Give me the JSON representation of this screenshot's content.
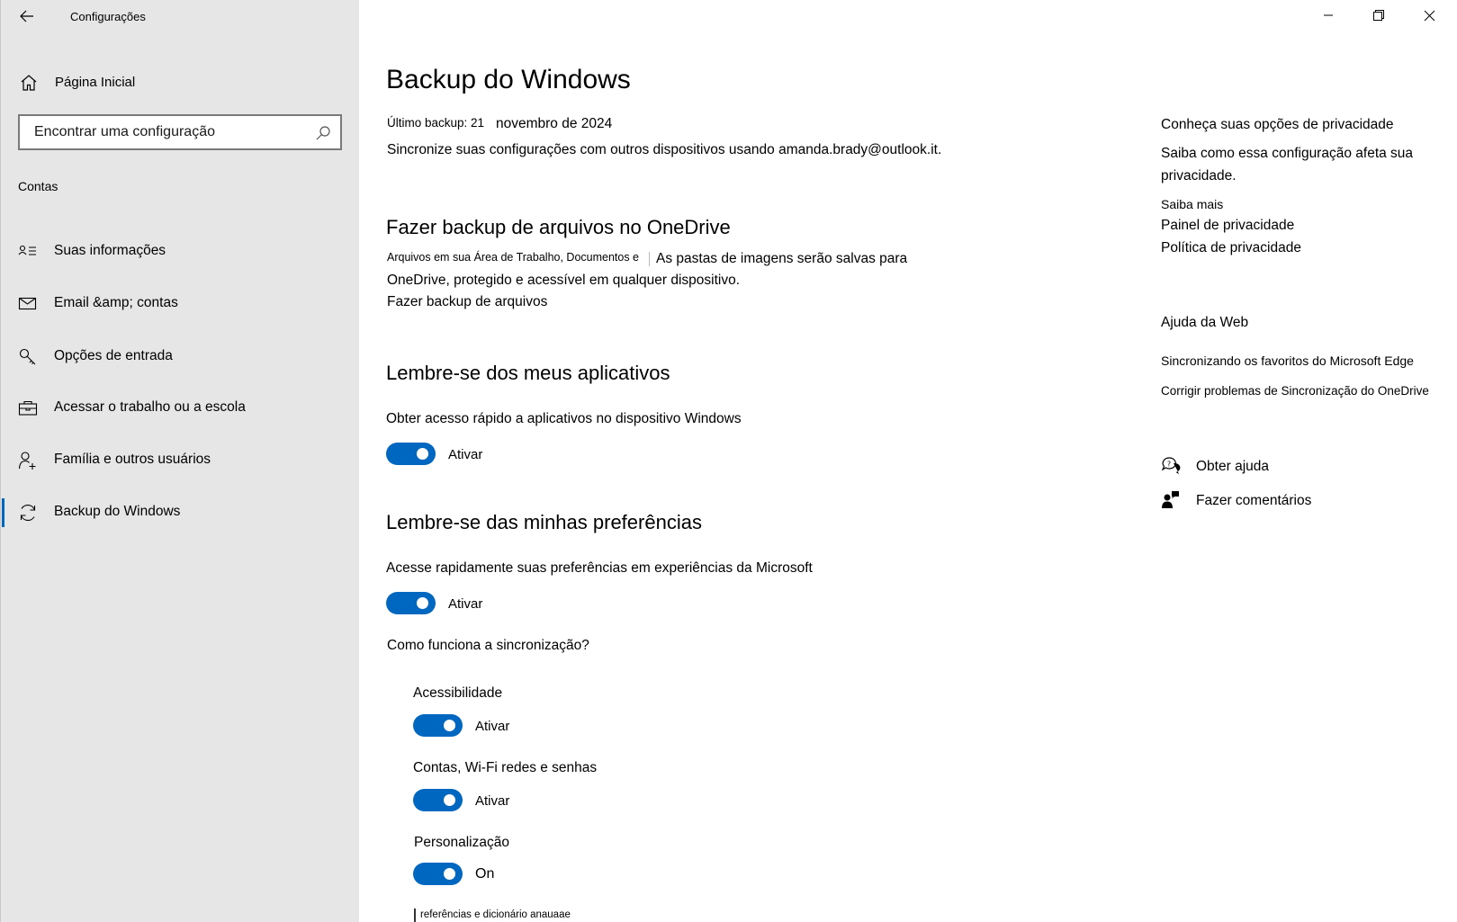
{
  "window": {
    "title": "Configurações",
    "caption_buttons": [
      "minimize-icon",
      "restore-icon",
      "close-icon"
    ]
  },
  "sidebar": {
    "home_label": "Página Inicial",
    "search_placeholder": "Encontrar uma configuração",
    "section_label": "Contas",
    "items": [
      {
        "label": "Suas informações",
        "icon": "person-card-icon"
      },
      {
        "label": "Email &amp; contas",
        "icon": "mail-icon"
      },
      {
        "label": "Opções de entrada",
        "icon": "key-icon"
      },
      {
        "label": "Acessar o trabalho ou a escola",
        "icon": "briefcase-icon"
      },
      {
        "label": "Família e outros usuários",
        "icon": "person-add-icon"
      },
      {
        "label": "Backup do Windows",
        "icon": "sync-icon",
        "active": true
      }
    ]
  },
  "main": {
    "title": "Backup do Windows",
    "last_backup_label": "Último backup: 21",
    "last_backup_date": "novembro de 2024",
    "sync_text": "Sincronize suas configurações com outros dispositivos usando amanda.brady@outlook.it.",
    "onedrive": {
      "heading": "Fazer backup de arquivos no OneDrive",
      "line1a": "Arquivos em sua Área de Trabalho, Documentos e",
      "line1b": "As pastas de imagens serão salvas para",
      "line2": "OneDrive, protegido e acessível em qualquer dispositivo.",
      "link": "Fazer backup de arquivos"
    },
    "apps": {
      "heading": "Lembre-se dos meus aplicativos",
      "description": "Obter acesso rápido a aplicativos no dispositivo Windows",
      "toggle_label": "Ativar"
    },
    "prefs": {
      "heading": "Lembre-se das minhas preferências",
      "description": "Acesse rapidamente suas preferências em experiências da Microsoft",
      "toggle_label": "Ativar",
      "how_link": "Como funciona a sincronização?",
      "sub_items": [
        {
          "label": "Acessibilidade",
          "toggle_label": "Ativar"
        },
        {
          "label": "Contas, Wi-Fi redes e senhas",
          "toggle_label": "Ativar"
        },
        {
          "label": "Personalização",
          "toggle_label": "On"
        }
      ],
      "cut_off_text": "referências e dicionário anauaae"
    }
  },
  "right": {
    "privacy_heading": "Conheça suas opções de privacidade",
    "privacy_desc_1": "Saiba como essa configuração afeta sua",
    "privacy_desc_2": "privacidade.",
    "learn_more": "Saiba mais",
    "privacy_dashboard": "Painel de privacidade",
    "privacy_policy": "Política de privacidade",
    "web_help_heading": "Ajuda da Web",
    "web_link_1": "Sincronizando os favoritos do Microsoft Edge",
    "web_link_2": "Corrigir problemas de Sincronização do OneDrive",
    "get_help": "Obter ajuda",
    "feedback": "Fazer comentários"
  },
  "colors": {
    "accent": "#0067c0",
    "sidebar_bg": "#e6e6e6"
  }
}
